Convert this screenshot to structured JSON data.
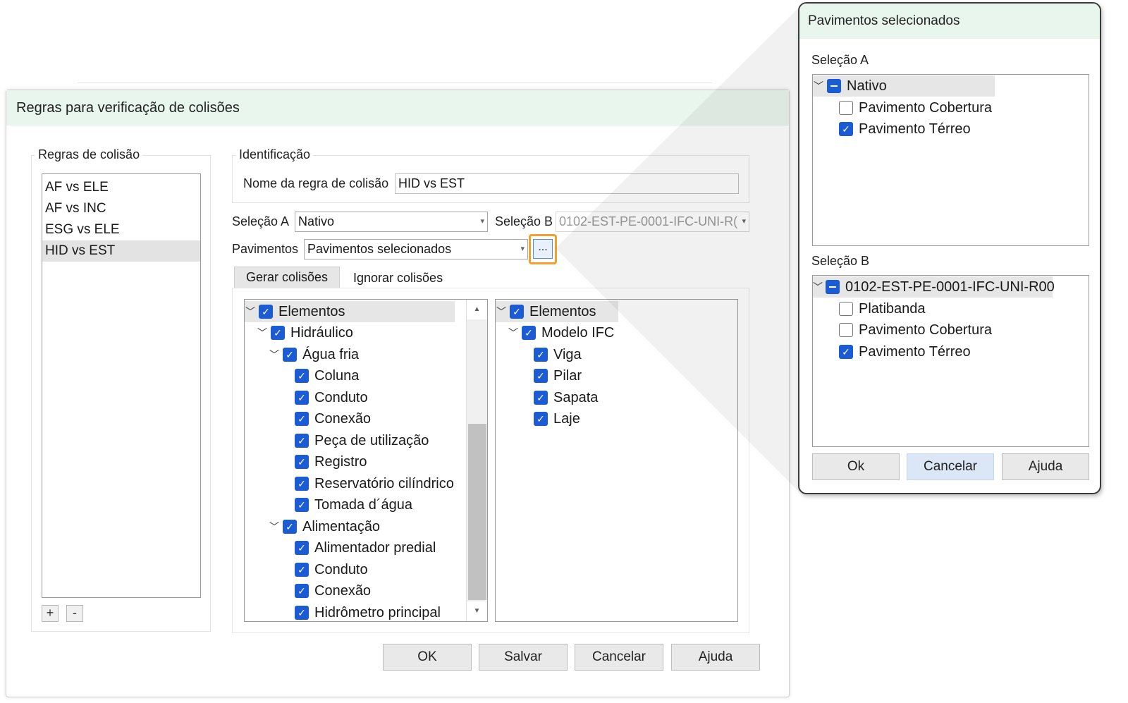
{
  "main_dialog": {
    "title": "Regras para verificação de colisões",
    "rules_group": {
      "legend": "Regras de colisão",
      "items": [
        {
          "label": "AF vs ELE"
        },
        {
          "label": "AF vs INC"
        },
        {
          "label": "ESG vs ELE"
        },
        {
          "label": "HID vs EST"
        }
      ],
      "add_label": "+",
      "remove_label": "-"
    },
    "identification": {
      "legend": "Identificação",
      "name_label": "Nome da regra de colisão",
      "name_value": "HID vs EST"
    },
    "selection_a": {
      "label": "Seleção A",
      "value": "Nativo"
    },
    "selection_b": {
      "label": "Seleção B",
      "value": "0102-EST-PE-0001-IFC-UNI-R("
    },
    "pavimentos": {
      "label": "Pavimentos",
      "value": "Pavimentos selecionados",
      "browse_label": "..."
    },
    "tabs": [
      {
        "label": "Gerar colisões"
      },
      {
        "label": "Ignorar colisões"
      }
    ],
    "tree_a": [
      {
        "label": "Elementos"
      },
      {
        "label": "Hidráulico"
      },
      {
        "label": "Água fria"
      },
      {
        "label": "Coluna"
      },
      {
        "label": "Conduto"
      },
      {
        "label": "Conexão"
      },
      {
        "label": "Peça de utilização"
      },
      {
        "label": "Registro"
      },
      {
        "label": "Reservatório cilíndrico"
      },
      {
        "label": "Tomada d´água"
      },
      {
        "label": "Alimentação"
      },
      {
        "label": "Alimentador predial"
      },
      {
        "label": "Conduto"
      },
      {
        "label": "Conexão"
      },
      {
        "label": "Hidrômetro principal"
      }
    ],
    "tree_b": [
      {
        "label": "Elementos"
      },
      {
        "label": "Modelo IFC"
      },
      {
        "label": "Viga"
      },
      {
        "label": "Pilar"
      },
      {
        "label": "Sapata"
      },
      {
        "label": "Laje"
      }
    ],
    "buttons": {
      "ok": "OK",
      "save": "Salvar",
      "cancel": "Cancelar",
      "help": "Ajuda"
    }
  },
  "popup": {
    "title": "Pavimentos selecionados",
    "selection_a": {
      "label": "Seleção A",
      "root": "Nativo",
      "items": [
        {
          "label": "Pavimento Cobertura",
          "checked": false
        },
        {
          "label": "Pavimento Térreo",
          "checked": true
        }
      ]
    },
    "selection_b": {
      "label": "Seleção B",
      "root": "0102-EST-PE-0001-IFC-UNI-R00",
      "items": [
        {
          "label": "Platibanda",
          "checked": false
        },
        {
          "label": "Pavimento Cobertura",
          "checked": false
        },
        {
          "label": "Pavimento Térreo",
          "checked": true
        }
      ]
    },
    "buttons": {
      "ok": "Ok",
      "cancel": "Cancelar",
      "help": "Ajuda"
    }
  },
  "colors": {
    "title_bar": "#e9f6ee",
    "checkbox": "#1b5bd4",
    "highlight": "#f0a030",
    "selection": "#e3e3e3"
  }
}
